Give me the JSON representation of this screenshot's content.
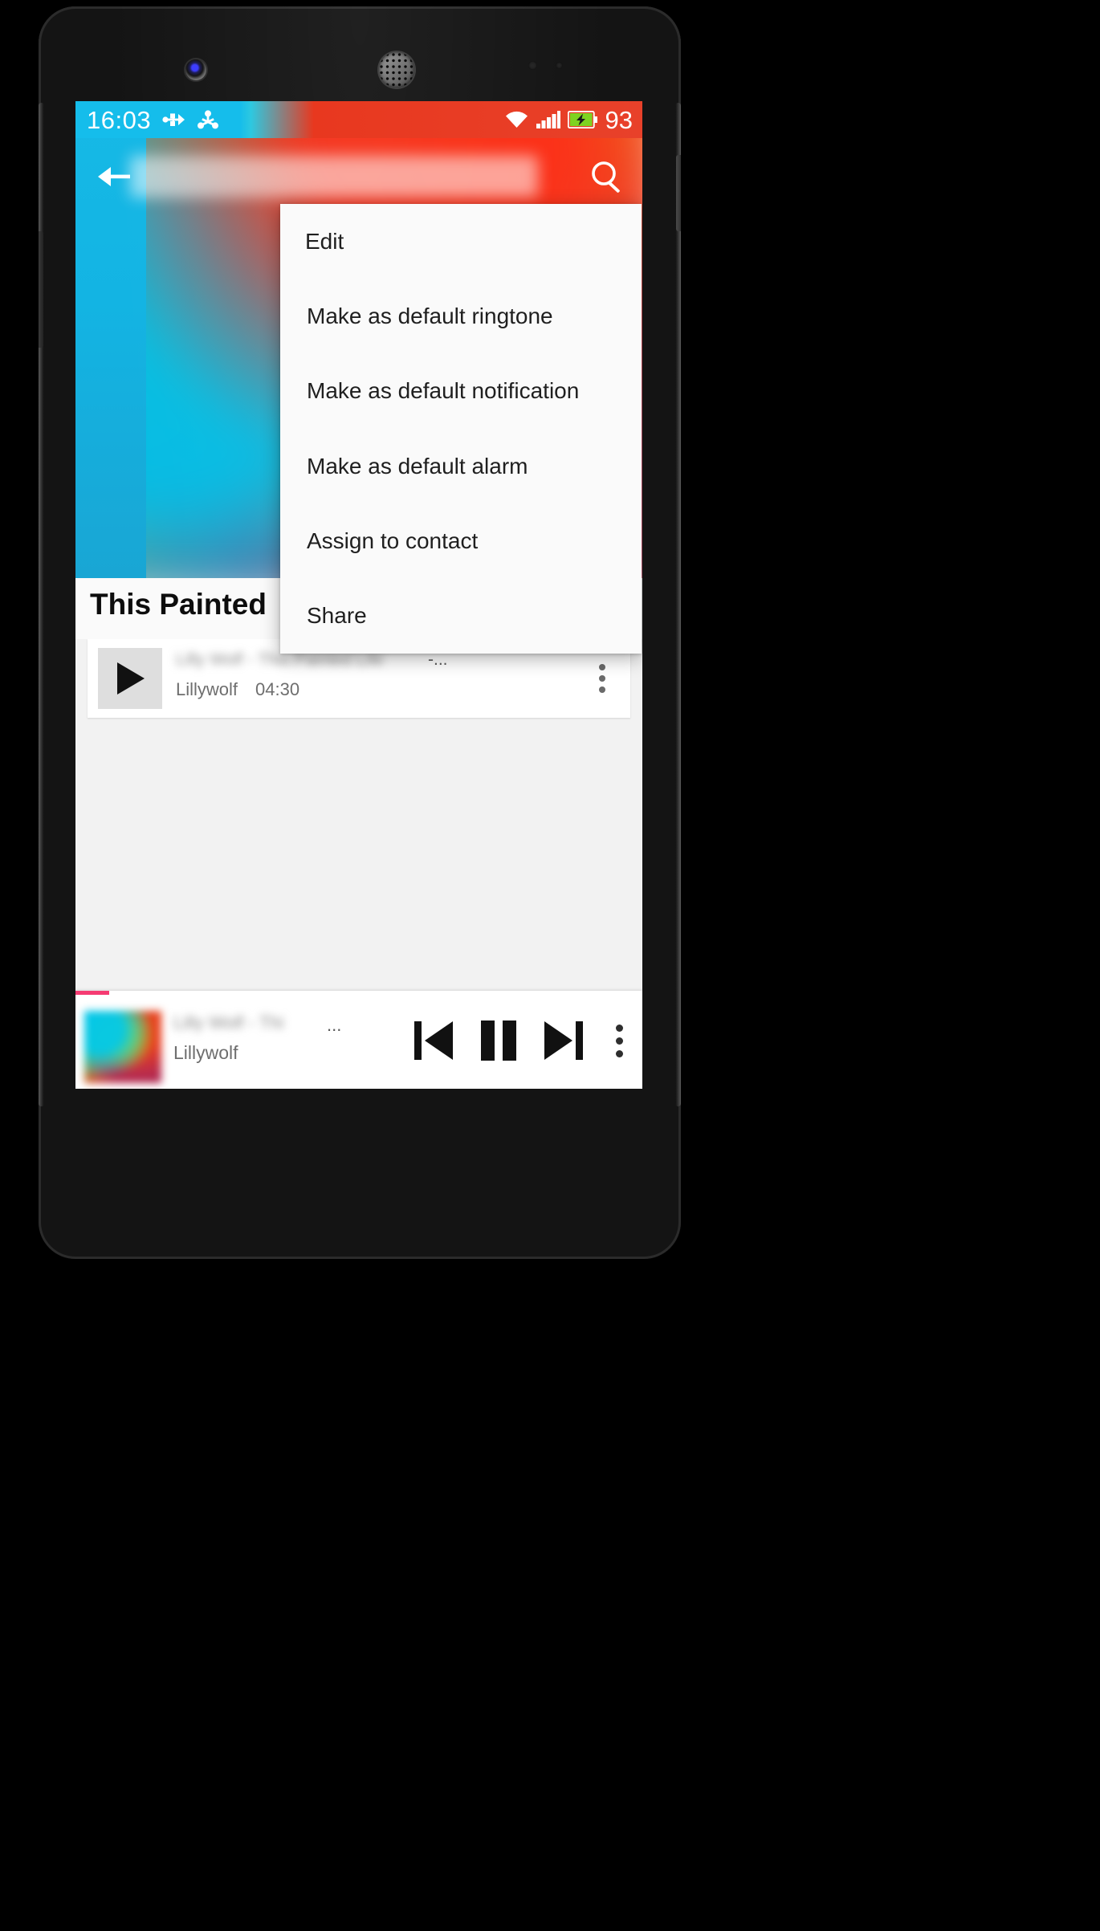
{
  "status_bar": {
    "clock": "16:03",
    "battery_percent": "93",
    "icons": [
      "usb-icon",
      "share-icon",
      "wifi-icon",
      "cellular-signal-icon",
      "battery-charging-icon"
    ]
  },
  "app_bar": {
    "back_label": "back-arrow-icon",
    "search_label": "search-icon",
    "title": ""
  },
  "album": {
    "title": "This Painted"
  },
  "song_row": {
    "title": "Lilly Wolf - This Painted Life",
    "title_ellipsis": "-...",
    "artist": "Lillywolf",
    "duration": "04:30",
    "play_icon": "play-icon",
    "overflow_icon": "overflow-menu-icon"
  },
  "popup_menu": {
    "items": [
      {
        "label": "Edit"
      },
      {
        "label": "Make as default ringtone"
      },
      {
        "label": "Make as default notification"
      },
      {
        "label": "Make as default alarm"
      },
      {
        "label": "Assign to contact"
      },
      {
        "label": "Share"
      }
    ]
  },
  "mini_player": {
    "title": "Lilly Wolf - Thi",
    "title_ellipsis": "...",
    "artist": "Lillywolf",
    "previous_icon": "skip-previous-icon",
    "pause_icon": "pause-icon",
    "next_icon": "skip-next-icon",
    "overflow_icon": "overflow-menu-icon",
    "progress_percent": 6
  },
  "colors": {
    "accent_pink": "#f53b72",
    "status_red": "#e8381f",
    "status_cyan": "#15bdeb",
    "menu_bg": "#fafafa",
    "text_primary": "#1f1f1f",
    "text_secondary": "#6e6e6e"
  }
}
